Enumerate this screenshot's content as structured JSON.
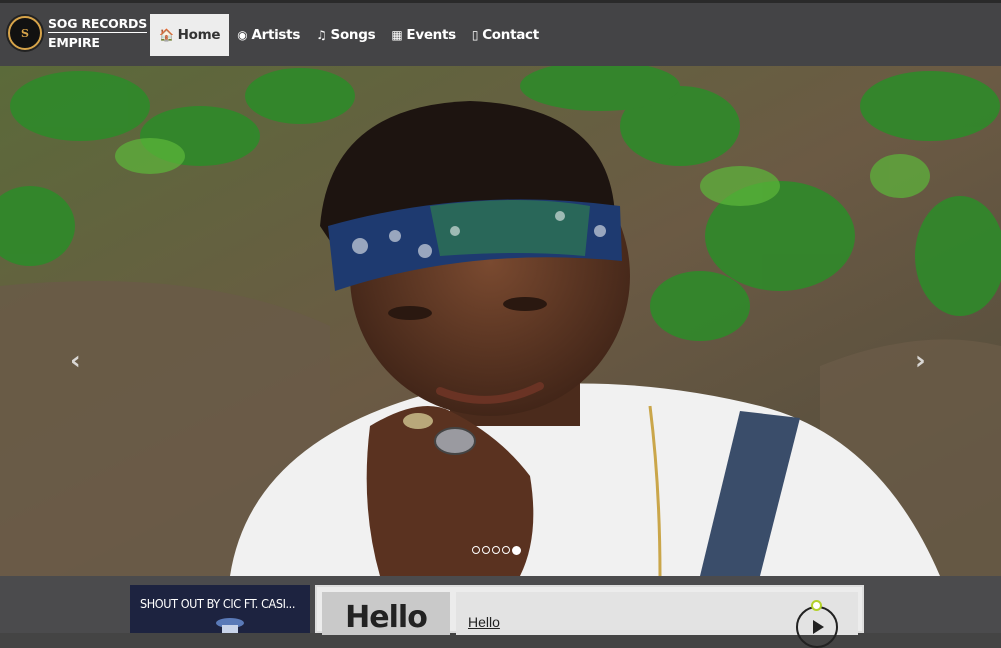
{
  "brand": {
    "line1": "SOG RECORDS",
    "line2": "EMPIRE",
    "logo_text": "S"
  },
  "nav": [
    {
      "label": "Home",
      "icon": "home-icon",
      "glyph": "🏠",
      "active": true
    },
    {
      "label": "Artists",
      "icon": "user-circle-icon",
      "glyph": "◉"
    },
    {
      "label": "Songs",
      "icon": "music-note-icon",
      "glyph": "♫"
    },
    {
      "label": "Events",
      "icon": "calendar-icon",
      "glyph": "▦"
    },
    {
      "label": "Contact",
      "icon": "phone-icon",
      "glyph": "▯"
    }
  ],
  "carousel": {
    "prev_glyph": "‹",
    "next_glyph": "›",
    "slides": 5,
    "active_slide": 5
  },
  "video": {
    "title": "SHOUT OUT BY CIC FT. CASI..."
  },
  "player": {
    "cover_text": "Hello",
    "track_title": "Hello"
  },
  "colors": {
    "navbar": "#444446",
    "active_tab": "#ededed",
    "knob": "#b3d12a"
  }
}
